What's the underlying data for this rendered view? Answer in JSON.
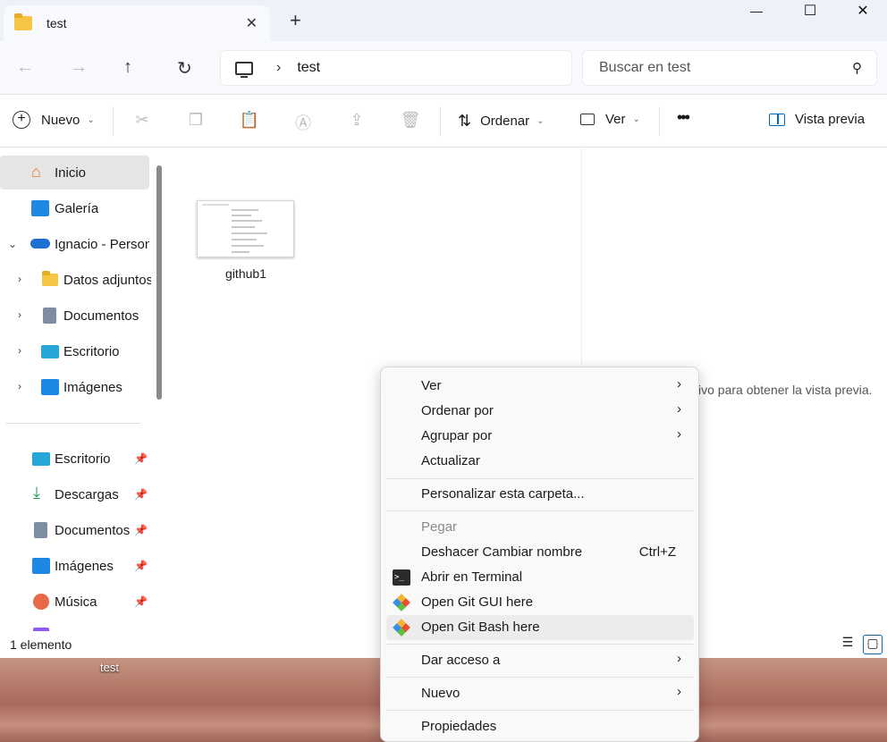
{
  "tab": {
    "title": "test",
    "close": "✕",
    "new": "+"
  },
  "window_controls": {
    "minimize": "—",
    "maximize": "☐",
    "close": "✕"
  },
  "address": {
    "path": "test",
    "chevron": "›"
  },
  "search": {
    "placeholder": "Buscar en test"
  },
  "toolbar": {
    "new_label": "Nuevo",
    "sort_label": "Ordenar",
    "view_label": "Ver",
    "more_label": "•••",
    "preview_label": "Vista previa"
  },
  "sidebar": {
    "items": [
      {
        "label": "Inicio",
        "icon": "home-icon"
      },
      {
        "label": "Galería",
        "icon": "gallery-icon"
      },
      {
        "label": "Ignacio - Personal",
        "icon": "onedrive-icon"
      },
      {
        "label": "Datos adjuntos",
        "icon": "folder-icon"
      },
      {
        "label": "Documentos",
        "icon": "document-icon"
      },
      {
        "label": "Escritorio",
        "icon": "desktop-icon"
      },
      {
        "label": "Imágenes",
        "icon": "pictures-icon"
      }
    ],
    "quick_access": [
      {
        "label": "Escritorio",
        "icon": "desktop-icon"
      },
      {
        "label": "Descargas",
        "icon": "download-icon"
      },
      {
        "label": "Documentos",
        "icon": "document-icon"
      },
      {
        "label": "Imágenes",
        "icon": "pictures-icon"
      },
      {
        "label": "Música",
        "icon": "music-icon"
      }
    ]
  },
  "files": [
    {
      "name": "github1"
    }
  ],
  "preview": {
    "text": "ivo para obtener la vista previa."
  },
  "status": {
    "count": "1 elemento"
  },
  "desktop": {
    "label": "test"
  },
  "context_menu": {
    "ver": "Ver",
    "ordenar_por": "Ordenar por",
    "agrupar_por": "Agrupar por",
    "actualizar": "Actualizar",
    "personalizar": "Personalizar esta carpeta...",
    "pegar": "Pegar",
    "deshacer": "Deshacer Cambiar nombre",
    "deshacer_shortcut": "Ctrl+Z",
    "abrir_terminal": "Abrir en Terminal",
    "git_gui": "Open Git GUI here",
    "git_bash": "Open Git Bash here",
    "dar_acceso": "Dar acceso a",
    "nuevo": "Nuevo",
    "propiedades": "Propiedades",
    "arrow": "›"
  },
  "colors": {
    "accent": "#0067c0",
    "folder": "#f6c544",
    "selection": "#e5e5e5"
  }
}
